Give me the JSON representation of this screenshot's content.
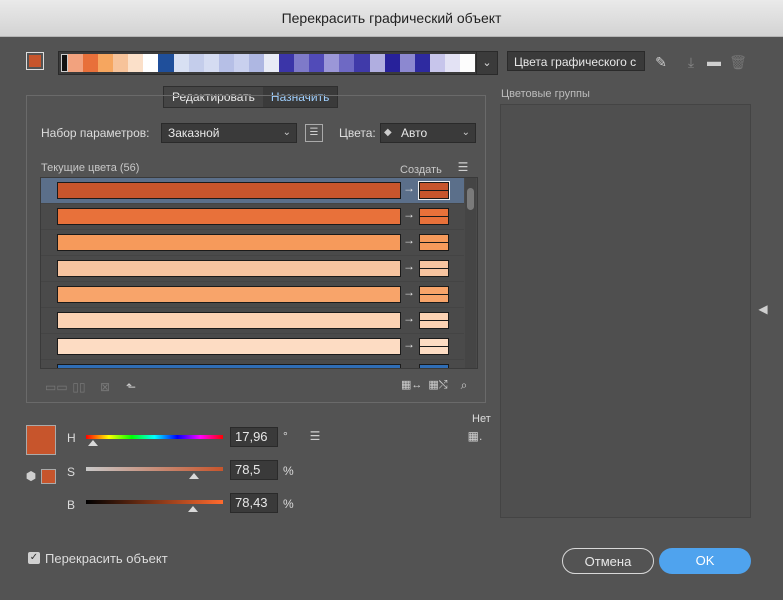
{
  "window": {
    "title": "Перекрасить графический объект"
  },
  "colors": {
    "current": "#c7552c",
    "list_rows": [
      {
        "bar": "#c7552c",
        "target": "#c7552c"
      },
      {
        "bar": "#e8713a",
        "target": "#e8713a"
      },
      {
        "bar": "#f69a5b",
        "target": "#f69a5b"
      },
      {
        "bar": "#f7c4a0",
        "target": "#f7c4a0"
      },
      {
        "bar": "#f8a46a",
        "target": "#f8a46a"
      },
      {
        "bar": "#fcd2b3",
        "target": "#fcd2b3"
      },
      {
        "bar": "#fddcc3",
        "target": "#fddcc3"
      },
      {
        "bar": "#2f6db5",
        "target": "#2f6db5"
      }
    ],
    "strip": [
      "#111",
      "#f2a27e",
      "#e8703a",
      "#f6a65f",
      "#f7c39a",
      "#fbe0c9",
      "#fff",
      "#1f4f9b",
      "#d8e0f3",
      "#c4cdeb",
      "#d5dcf2",
      "#b6bfe6",
      "#c9d0ee",
      "#aeb7e2",
      "#e8ebf6",
      "#3b35a8",
      "#7e7ac9",
      "#514bb8",
      "#9b97d8",
      "#6e69c4",
      "#403aa9",
      "#b0aee0",
      "#27219a",
      "#8c88d0",
      "#2e2aa0",
      "#c7c5eb",
      "#e3e2f4",
      "#fdfdfd"
    ]
  },
  "top": {
    "name_field": "Цвета графического с"
  },
  "tabs": [
    {
      "label": "Редактировать"
    },
    {
      "label": "Назначить"
    }
  ],
  "preset": {
    "label": "Набор параметров:",
    "value": "Заказной"
  },
  "colors_select": {
    "label": "Цвета:",
    "value": "Авто"
  },
  "current_colors_label": "Текущие цвета (56)",
  "create_label": "Создать",
  "color_groups_label": "Цветовые группы",
  "hsb": {
    "h": {
      "label": "H",
      "value": "17,96",
      "unit": "°",
      "level": 0.05
    },
    "s": {
      "label": "S",
      "value": "78,5",
      "unit": "%",
      "level": 0.785
    },
    "b": {
      "label": "B",
      "value": "78,43",
      "unit": "%",
      "level": 0.7843
    }
  },
  "none_label": "Нет",
  "recolor": {
    "label": "Перекрасить объект",
    "checked": true
  },
  "buttons": {
    "cancel": "Отмена",
    "ok": "OK"
  }
}
